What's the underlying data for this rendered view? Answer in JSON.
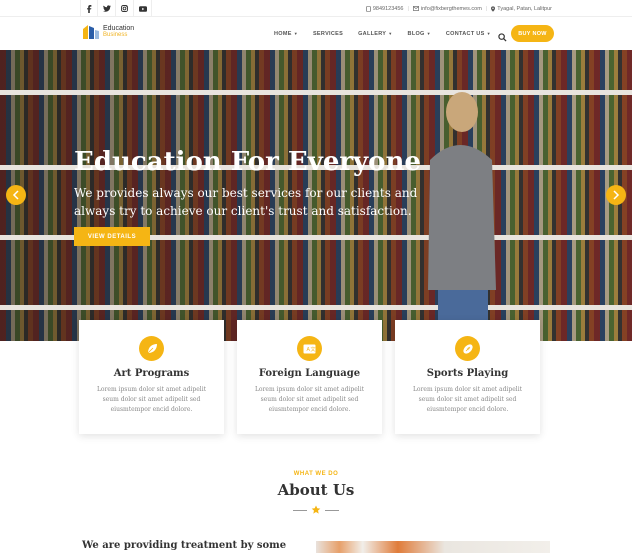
{
  "topbar": {
    "social": [
      "facebook-icon",
      "twitter-icon",
      "instagram-icon",
      "youtube-icon"
    ],
    "phone": "9849123456",
    "email": "info@fixbergthemes.com",
    "location": "Tyagal, Patan, Lalitpur"
  },
  "header": {
    "logo_line1": "Education",
    "logo_line2": "Business",
    "nav": [
      {
        "label": "HOME",
        "dropdown": true
      },
      {
        "label": "SERVICES",
        "dropdown": false
      },
      {
        "label": "GALLERY",
        "dropdown": true
      },
      {
        "label": "BLOG",
        "dropdown": true
      },
      {
        "label": "CONTACT US",
        "dropdown": true
      }
    ],
    "buy_label": "BUY NOW"
  },
  "hero": {
    "title": "Education For Everyone",
    "subtitle": "We provides always our best services for our clients and always try to achieve our client's trust and satisfaction.",
    "button": "VIEW DETAILS"
  },
  "cards": [
    {
      "title": "Art Programs",
      "desc": "Lorem ipsum dolor sit amet adipelit seum dolor sit amet adipelit sed eiusmtempor encid dolore.",
      "icon": "leaf-icon"
    },
    {
      "title": "Foreign Language",
      "desc": "Lorem ipsum dolor sit amet adipelit seum dolor sit amet adipelit sed eiusmtempor encid dolore.",
      "icon": "language-icon"
    },
    {
      "title": "Sports Playing",
      "desc": "Lorem ipsum dolor sit amet adipelit seum dolor sit amet adipelit sed eiusmtempor encid dolore.",
      "icon": "football-icon"
    }
  ],
  "about": {
    "eyebrow": "WHAT WE DO",
    "title": "About Us",
    "text": "We are providing treatment by some"
  },
  "colors": {
    "accent": "#f5b514"
  }
}
